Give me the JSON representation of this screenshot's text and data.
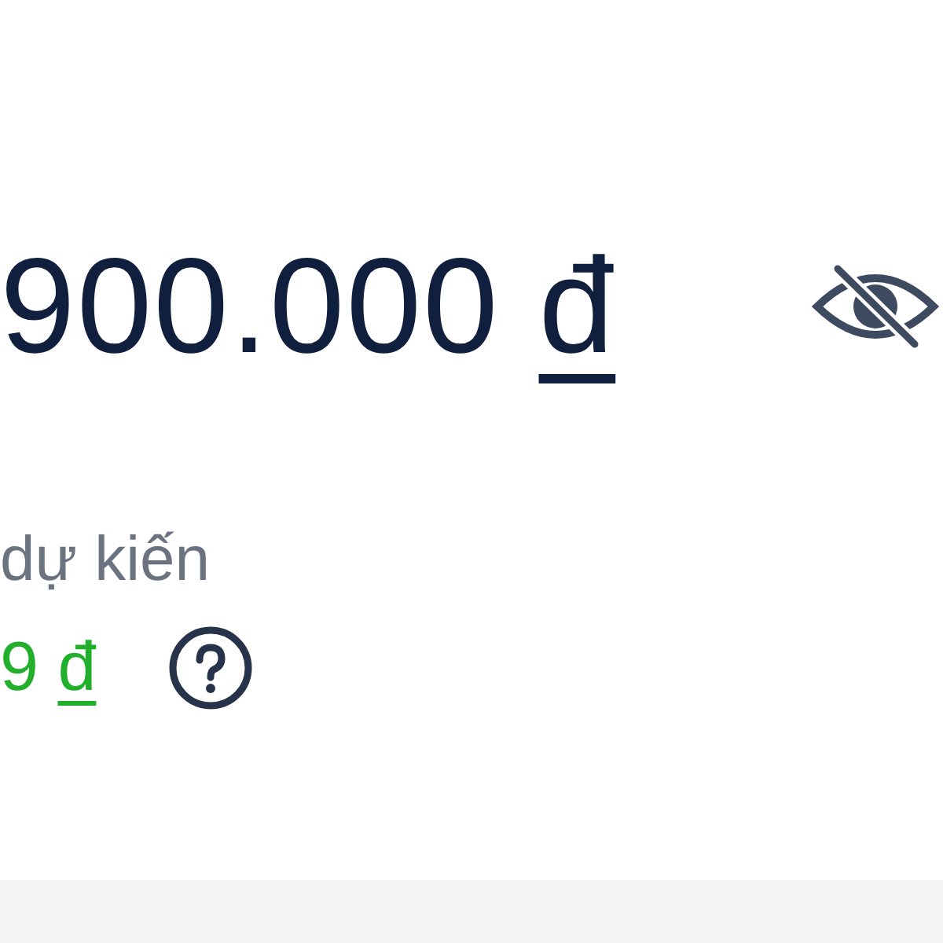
{
  "balance": {
    "amount": "900.000",
    "currency": "đ"
  },
  "expected": {
    "label": "dự kiến",
    "amount": "9",
    "currency": "đ"
  }
}
